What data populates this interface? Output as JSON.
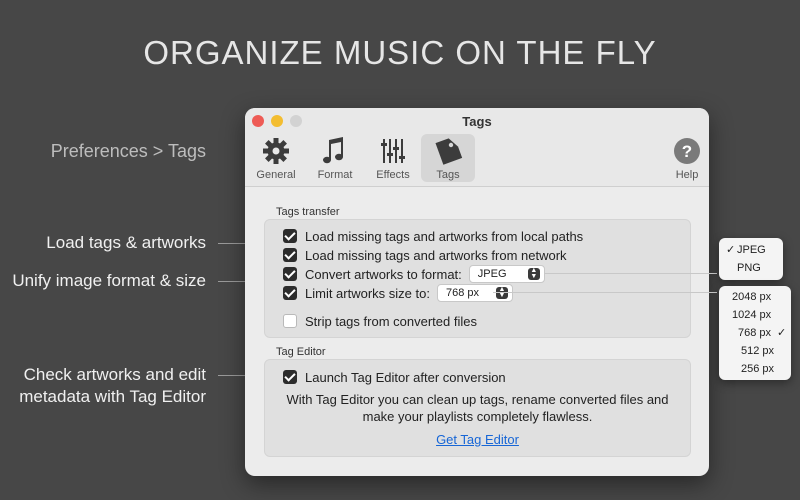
{
  "headline": "ORGANIZE MUSIC ON THE FLY",
  "side_labels": {
    "breadcrumb": "Preferences > Tags",
    "load_tags": "Load tags & artworks",
    "unify_format": "Unify image format & size",
    "tag_editor_line1": "Check artworks and edit",
    "tag_editor_line2": "metadata with Tag Editor"
  },
  "window": {
    "title": "Tags",
    "toolbar": [
      {
        "label": "General",
        "icon": "gear-icon"
      },
      {
        "label": "Format",
        "icon": "music-note-icon"
      },
      {
        "label": "Effects",
        "icon": "sliders-icon"
      },
      {
        "label": "Tags",
        "icon": "tag-icon",
        "active": true
      },
      {
        "label": "Help",
        "icon": "question-icon"
      }
    ],
    "tags_transfer": {
      "title": "Tags transfer",
      "options": [
        {
          "label": "Load missing tags and artworks from local paths",
          "checked": true
        },
        {
          "label": "Load missing tags and artworks from network",
          "checked": true
        },
        {
          "label": "Convert artworks to format:",
          "checked": true,
          "popup": "JPEG"
        },
        {
          "label": "Limit artworks size to:",
          "checked": true,
          "popup": "768 px"
        },
        {
          "label": "Strip tags from converted files",
          "checked": false
        }
      ]
    },
    "tag_editor": {
      "title": "Tag Editor",
      "option": {
        "label": "Launch Tag Editor after conversion",
        "checked": true
      },
      "desc_line1": "With Tag Editor you can clean up tags, rename converted files and",
      "desc_line2": "make your playlists completely flawless.",
      "link": "Get Tag Editor"
    }
  },
  "format_menu": {
    "options": [
      {
        "label": "JPEG",
        "selected": true
      },
      {
        "label": "PNG",
        "selected": false
      }
    ]
  },
  "size_menu": {
    "options": [
      {
        "label": "2048 px",
        "selected": false
      },
      {
        "label": "1024 px",
        "selected": false
      },
      {
        "label": "768 px",
        "selected": true
      },
      {
        "label": "512 px",
        "selected": false
      },
      {
        "label": "256 px",
        "selected": false
      }
    ]
  },
  "checkmark": "✓"
}
